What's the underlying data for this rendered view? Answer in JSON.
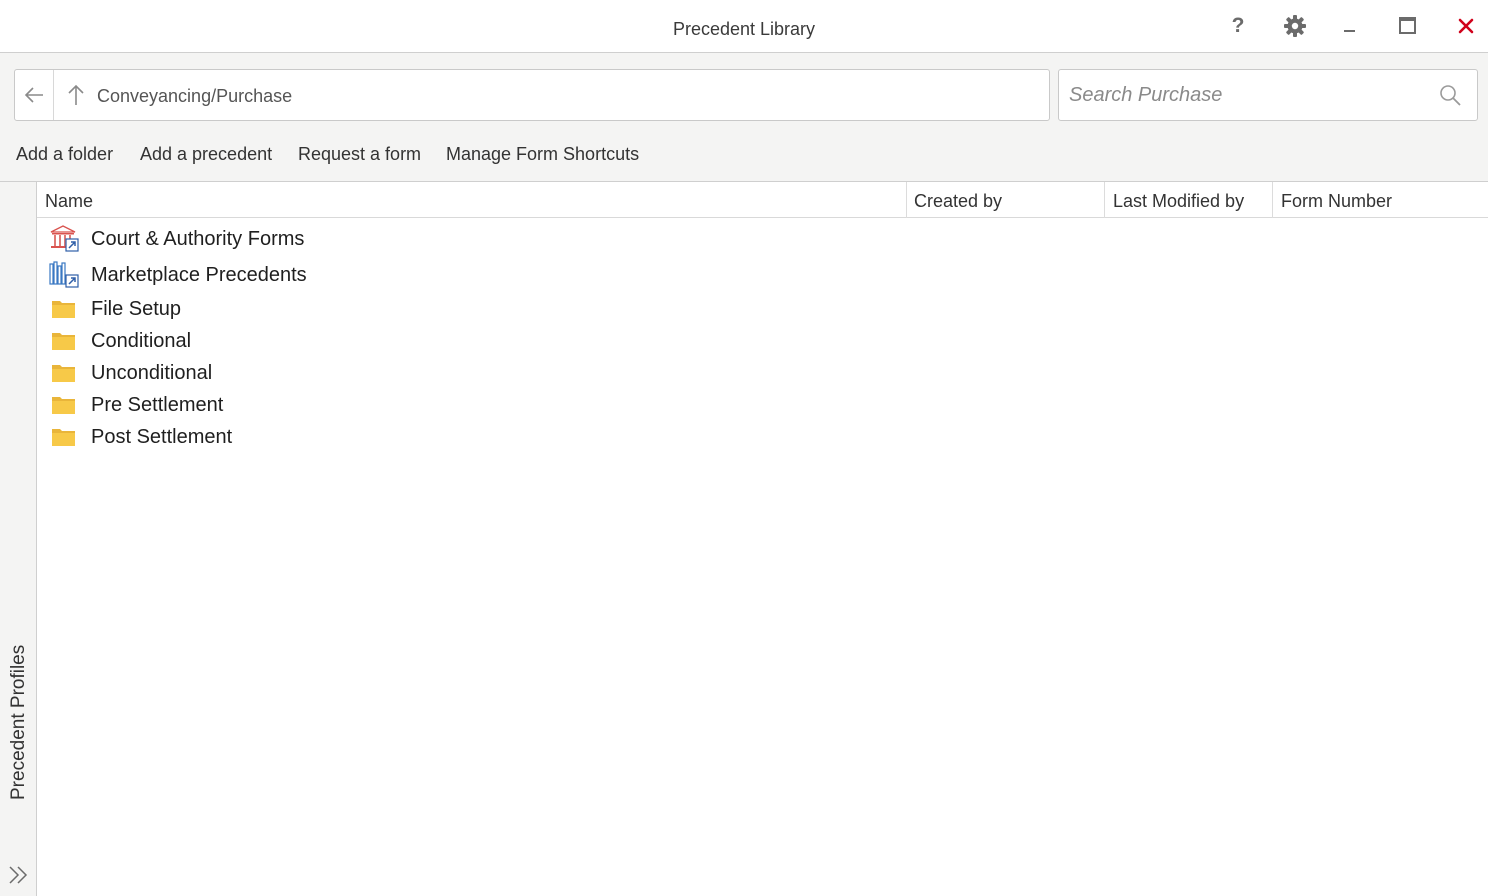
{
  "window": {
    "title": "Precedent Library",
    "help_label": "?"
  },
  "navigation": {
    "path": "Conveyancing/Purchase"
  },
  "search": {
    "placeholder": "Search Purchase",
    "value": ""
  },
  "toolbar": {
    "add_folder": "Add a folder",
    "add_precedent": "Add a precedent",
    "request_form": "Request a form",
    "manage_shortcuts": "Manage Form Shortcuts"
  },
  "sidebar": {
    "label": "Precedent Profiles"
  },
  "grid": {
    "columns": [
      "Name",
      "Created by",
      "Last Modified by",
      "Form Number"
    ],
    "rows": [
      {
        "name": "Court & Authority Forms",
        "icon": "court-shortcut-icon"
      },
      {
        "name": "Marketplace Precedents",
        "icon": "marketplace-shortcut-icon"
      },
      {
        "name": "File Setup",
        "icon": "folder-icon"
      },
      {
        "name": "Conditional",
        "icon": "folder-icon"
      },
      {
        "name": "Unconditional",
        "icon": "folder-icon"
      },
      {
        "name": "Pre Settlement",
        "icon": "folder-icon"
      },
      {
        "name": "Post Settlement",
        "icon": "folder-icon"
      }
    ]
  },
  "colors": {
    "close": "#d0021b",
    "folder": "#f7c948",
    "court_icon": "#d9534f",
    "marketplace_icon": "#3a78c3",
    "shortcut_arrow": "#2f5fa8"
  }
}
